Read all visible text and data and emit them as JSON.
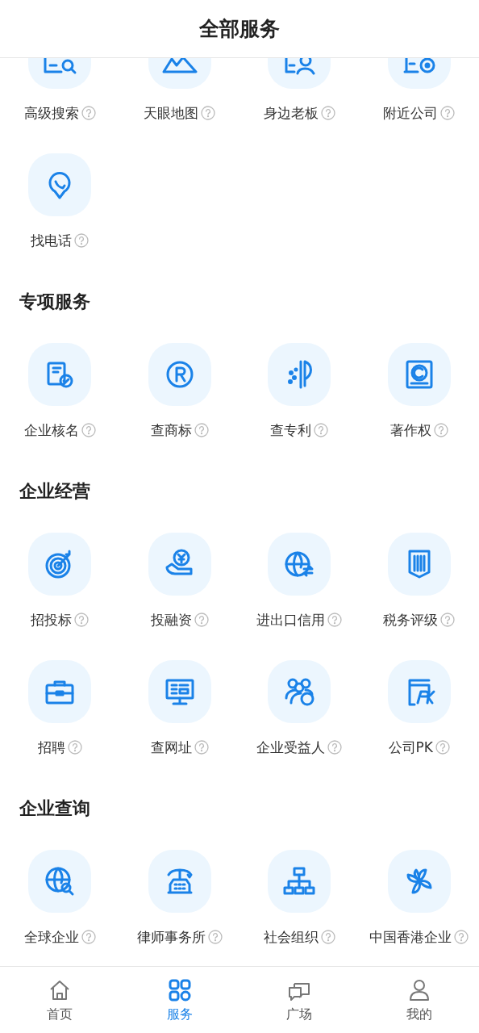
{
  "header": {
    "title": "全部服务"
  },
  "sections": [
    {
      "items": [
        {
          "label": "高级搜索"
        },
        {
          "label": "天眼地图"
        },
        {
          "label": "身边老板"
        },
        {
          "label": "附近公司"
        },
        {
          "label": "找电话"
        }
      ]
    },
    {
      "title": "专项服务",
      "items": [
        {
          "label": "企业核名"
        },
        {
          "label": "查商标"
        },
        {
          "label": "查专利"
        },
        {
          "label": "著作权"
        }
      ]
    },
    {
      "title": "企业经营",
      "items": [
        {
          "label": "招投标"
        },
        {
          "label": "投融资"
        },
        {
          "label": "进出口信用"
        },
        {
          "label": "税务评级"
        },
        {
          "label": "招聘"
        },
        {
          "label": "查网址"
        },
        {
          "label": "企业受益人"
        },
        {
          "label": "公司PK"
        }
      ]
    },
    {
      "title": "企业查询",
      "items": [
        {
          "label": "全球企业"
        },
        {
          "label": "律师事务所"
        },
        {
          "label": "社会组织"
        },
        {
          "label": "中国香港企业"
        }
      ]
    }
  ],
  "tab_bar": [
    {
      "label": "首页",
      "selected": false
    },
    {
      "label": "服务",
      "selected": true
    },
    {
      "label": "广场",
      "selected": false
    },
    {
      "label": "我的",
      "selected": false
    }
  ]
}
